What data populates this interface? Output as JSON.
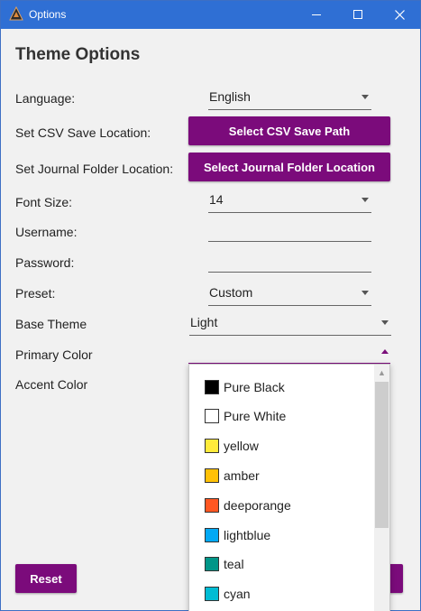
{
  "window": {
    "title": "Options"
  },
  "page": {
    "heading": "Theme Options"
  },
  "rows": {
    "language": {
      "label": "Language:",
      "value": "English"
    },
    "csv": {
      "label": "Set CSV Save Location:",
      "button": "Select CSV Save Path"
    },
    "journal": {
      "label": "Set Journal Folder Location:",
      "button": "Select Journal Folder Location"
    },
    "font_size": {
      "label": "Font Size:",
      "value": "14"
    },
    "username": {
      "label": "Username:",
      "value": ""
    },
    "password": {
      "label": "Password:",
      "value": ""
    },
    "preset": {
      "label": "Preset:",
      "value": "Custom"
    },
    "base_theme": {
      "label": "Base Theme",
      "value": "Light"
    },
    "primary_color": {
      "label": "Primary Color",
      "value": ""
    },
    "accent_color": {
      "label": "Accent Color"
    }
  },
  "buttons": {
    "reset": "Reset"
  },
  "dropdown": {
    "items": [
      {
        "label": "Pure Black",
        "color": "#000000"
      },
      {
        "label": "Pure White",
        "color": "#ffffff"
      },
      {
        "label": "yellow",
        "color": "#ffeb3b"
      },
      {
        "label": "amber",
        "color": "#ffc107"
      },
      {
        "label": "deeporange",
        "color": "#ff5722"
      },
      {
        "label": "lightblue",
        "color": "#03a9f4"
      },
      {
        "label": "teal",
        "color": "#009688"
      },
      {
        "label": "cyan",
        "color": "#00bcd4"
      }
    ]
  },
  "colors": {
    "accent": "#7b0b7b",
    "titlebar": "#2f6fd4"
  }
}
